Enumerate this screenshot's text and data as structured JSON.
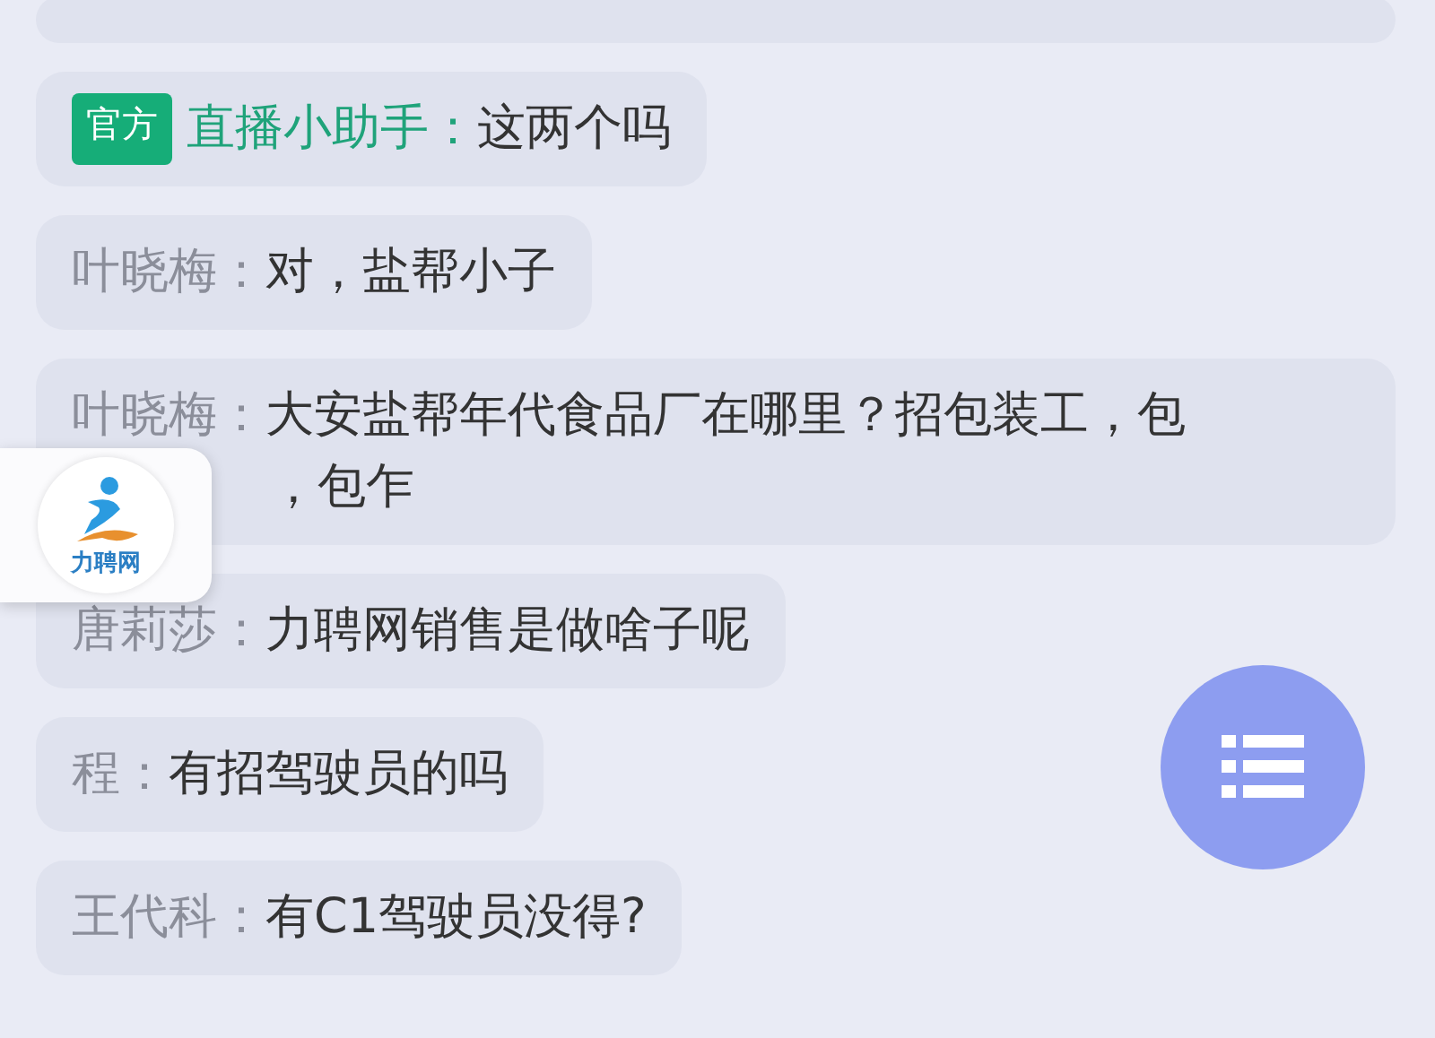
{
  "messages": [
    {
      "kind": "cut"
    },
    {
      "kind": "official",
      "badge": "官方",
      "name": "直播小助手：",
      "text": "这两个吗"
    },
    {
      "kind": "user",
      "name": "叶晓梅：",
      "text": "对，盐帮小子"
    },
    {
      "kind": "user",
      "name": "叶晓梅：",
      "text": "大安盐帮年代食品厂在哪里？招包装工，包",
      "continuation": "，包乍"
    },
    {
      "kind": "user",
      "name": "唐莉莎：",
      "text": "力聘网销售是做啥子呢"
    },
    {
      "kind": "user",
      "name": "程：",
      "text": "有招驾驶员的吗"
    },
    {
      "kind": "user",
      "name": "王代科：",
      "text": "有C1驾驶员没得?"
    }
  ],
  "floating_logo": {
    "text": "力聘网"
  }
}
